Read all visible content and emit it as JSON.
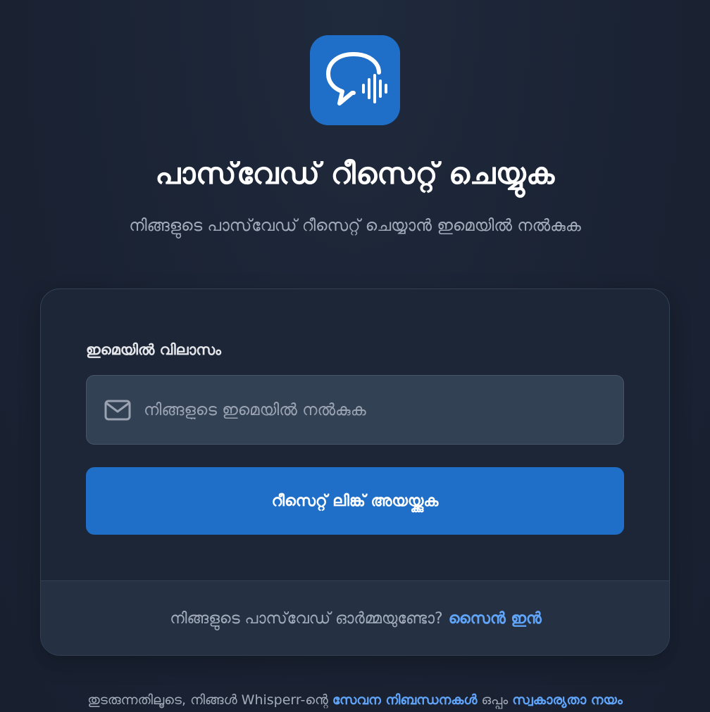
{
  "app": {
    "icon": "chat-bubble-waveform-icon",
    "brand_color": "#1f6fc9"
  },
  "header": {
    "title": "പാസ്‌വേഡ് റീസെറ്റ് ചെയ്യുക",
    "subtitle": "നിങ്ങളുടെ പാസ്‌വേഡ് റീസെറ്റ് ചെയ്യാൻ ഇമെയിൽ നൽകുക"
  },
  "form": {
    "email_label": "ഇമെയിൽ വിലാസം",
    "email_placeholder": "നിങ്ങളുടെ ഇമെയിൽ നൽകുക",
    "email_value": "",
    "email_icon": "mail-icon",
    "submit_label": "റീസെറ്റ് ലിങ്ക് അയയ്ക്കുക"
  },
  "footer": {
    "prompt": "നിങ്ങളുടെ പാസ്‌വേഡ് ഓർമ്മയുണ്ടോ?",
    "signin_label": "സൈൻ ഇൻ"
  },
  "legal": {
    "prefix": "തുടരുന്നതിലൂടെ, നിങ്ങൾ Whisperr-ന്റെ",
    "terms_label": "സേവന നിബന്ധനകൾ",
    "conjunction": "ഒപ്പം",
    "privacy_label": "സ്വകാര്യതാ നയം"
  },
  "colors": {
    "background": "#1a2233",
    "card": "#1d2637",
    "input": "#334155",
    "accent": "#1f6fc9",
    "link": "#60a5fa"
  }
}
